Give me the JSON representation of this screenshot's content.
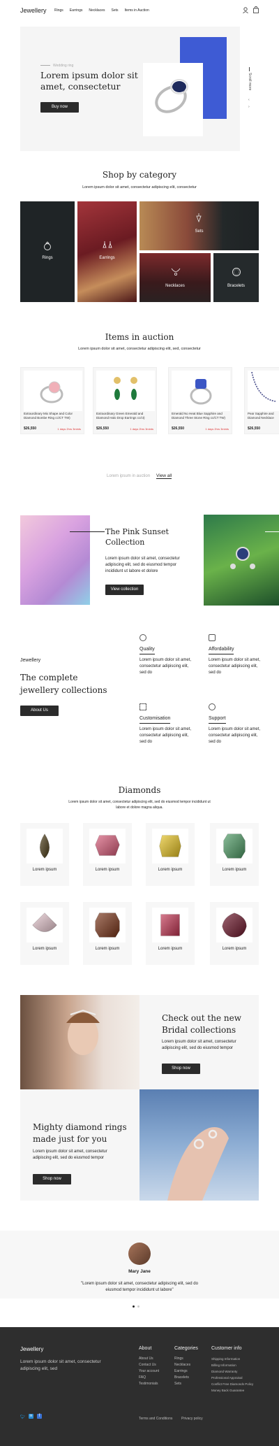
{
  "header": {
    "logo": "Jewellery",
    "nav": [
      "Rings",
      "Earrings",
      "Necklaces",
      "Sets",
      "Items in Auction"
    ]
  },
  "hero": {
    "subtitle": "Wedding ring",
    "title": "Lorem ipsum dolor sit amet, consectetur",
    "button": "Buy now",
    "side_label": "Scroll more"
  },
  "category": {
    "title": "Shop by category",
    "subtitle": "Lorem ipsum dolor sit amet, consectetur adipiscing elit, consectetur",
    "tiles": [
      "Rings",
      "Earrings",
      "Sets",
      "Necklaces",
      "Bracelets"
    ]
  },
  "auction": {
    "title": "Items in auction",
    "subtitle": "Lorem ipsum dolor sit amet, consectetur adipiscing elit, sed, consectetur",
    "cards": [
      {
        "name": "Extraordinary Mix Shape and Color Diamond Bombe Ring cc/CT TW)",
        "price": "$26,550",
        "time": "1 days 2hrs 3mints"
      },
      {
        "name": "Extraordinary Green Emerald and Diamond Halo Drop Earrings cc/ct)",
        "price": "$26,550",
        "time": "1 days 2hrs 3mints"
      },
      {
        "name": "Emerald No Heat Blue Sapphire and Diamond Three Stone Ring cc/CT TW)",
        "price": "$26,550",
        "time": "1 days 2hrs 3mints"
      },
      {
        "name": "Pear Sapphire and Diamond Necklace",
        "price": "$26,550",
        "time": ""
      }
    ],
    "more_text": "Lorem ipsum in auction",
    "view_all": "View all"
  },
  "collection": {
    "title": "The Pink Sunset Collection",
    "text": "Lorem ipsum dolor sit amet, consectetur adipiscing elit, sed do eiusmod tempor incididunt ut labore et dolore",
    "button": "View collection"
  },
  "about": {
    "label": "Jewellery",
    "title": "The complete jewellery collections",
    "button": "About Us",
    "features": [
      {
        "title": "Quality",
        "text": "Lorem ipsum dolor sit amet, consectetur adipiscing elit, sed do"
      },
      {
        "title": "Affordability",
        "text": "Lorem ipsum dolor sit amet, consectetur adipiscing elit, sed do"
      },
      {
        "title": "Customisation",
        "text": "Lorem ipsum dolor sit amet, consectetur adipiscing elit, sed do"
      },
      {
        "title": "Support",
        "text": "Lorem ipsum dolor sit amet, consectetur adipiscing elit, sed do"
      }
    ]
  },
  "diamonds": {
    "title": "Diamonds",
    "subtitle": "Lorem ipsum dolor sit amet, consectetur adipiscing elit, sed do eiusmod tempor incididunt ut labore et dolore magna aliqua.",
    "items": [
      {
        "label": "Lorem ipsum",
        "color": "#4a3a14"
      },
      {
        "label": "Lorem ipsum",
        "color": "#d85a78"
      },
      {
        "label": "Lorem ipsum",
        "color": "#e7c321"
      },
      {
        "label": "Lorem ipsum",
        "color": "#4c9a63"
      },
      {
        "label": "Lorem ipsum",
        "color": "#e8c8d0"
      },
      {
        "label": "Lorem ipsum",
        "color": "#7a3418"
      },
      {
        "label": "Lorem ipsum",
        "color": "#c23452"
      },
      {
        "label": "Lorem ipsum",
        "color": "#6b1428"
      }
    ]
  },
  "bridal": {
    "title": "Check out the new Bridal collections",
    "text": "Lorem ipsum dolor sit amet, consectetur adipiscing elit, sed do eiusmod tempor",
    "button": "Shop now"
  },
  "rings": {
    "title": "Mighty diamond rings made just for you",
    "text": "Lorem ipsum dolor sit amet, consectetur adipiscing elit, sed do eiusmod tempor",
    "button": "Shop now"
  },
  "testimonial": {
    "name": "Mary Jane",
    "quote": "\"Lorem ipsum dolor sit amet, consectetur adipiscing elit, sed do eiusmod tempor incididunt ut labore\""
  },
  "footer": {
    "logo": "Jewellery",
    "text": "Lorem ipsum dolor sit amet, consectetur adipiscing elit, sed",
    "about": {
      "title": "About",
      "links": [
        "About Us",
        "Contact Us",
        "Your account",
        "FAQ",
        "Testimonials"
      ]
    },
    "categories": {
      "title": "Categories",
      "links": [
        "Rings",
        "Necklaces",
        "Earrings",
        "Bracelets",
        "Sets"
      ]
    },
    "customer": {
      "title": "Customer info",
      "links": [
        "Shipping Information",
        "Billing Information",
        "Diamond Warranty",
        "Professional Appraisal",
        "Conflict Free Diamonds Policy",
        "Money Back Guarantee"
      ]
    },
    "terms": "Terms and Conditions",
    "privacy": "Privacy policy"
  }
}
